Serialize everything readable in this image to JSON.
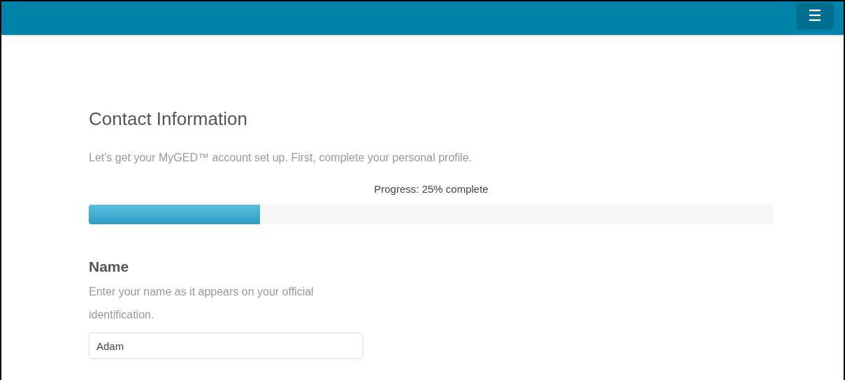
{
  "header": {
    "menu_button": "☰"
  },
  "page": {
    "title": "Contact Information",
    "intro": "Let's get your MyGED™ account set up. First, complete your personal profile."
  },
  "progress": {
    "label": "Progress: 25% complete",
    "level": 0.25
  },
  "name_section": {
    "heading": "Name",
    "hint": "Enter your name as it appears on your official identification.",
    "field": {
      "value": "Adam"
    }
  }
}
